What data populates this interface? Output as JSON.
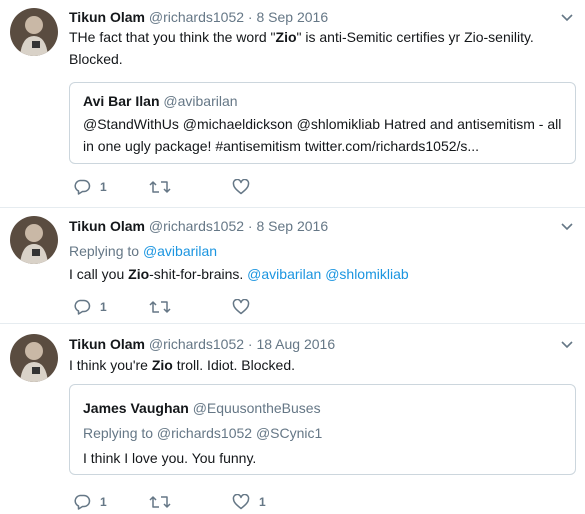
{
  "tweets": [
    {
      "name": "Tikun Olam",
      "handle": "@richards1052",
      "sep": "·",
      "date": "8 Sep 2016",
      "text_before": "THe fact that you think the word \"",
      "text_bold": "Zio",
      "text_after": "\" is anti-Semitic certifies yr Zio-senility. Blocked.",
      "quote": {
        "name": "Avi Bar Ilan",
        "handle": "@avibarilan",
        "text": "@StandWithUs @michaeldickson @shlomikliab Hatred and antisemitism - all in one ugly package! #antisemitism twitter.com/richards1052/s..."
      },
      "reply_count": "1",
      "retweet_count": "",
      "like_count": ""
    },
    {
      "name": "Tikun Olam",
      "handle": "@richards1052",
      "sep": "·",
      "date": "8 Sep 2016",
      "replying_label": "Replying to",
      "replying_to": "@avibarilan",
      "text_before": "I call you ",
      "text_bold": "Zio",
      "text_after": "-shit-for-brains. ",
      "mention1": "@avibarilan",
      "mention2": "@shlomikliab",
      "reply_count": "1",
      "retweet_count": "",
      "like_count": ""
    },
    {
      "name": "Tikun Olam",
      "handle": "@richards1052",
      "sep": "·",
      "date": "18 Aug 2016",
      "text_before": "I think you're ",
      "text_bold": "Zio",
      "text_after": " troll. Idiot. Blocked.",
      "quote": {
        "name": "James Vaughan",
        "handle": "@EquusontheBuses",
        "replying": "Replying to @richards1052 @SCynic1",
        "text": "I think I love you. You funny."
      },
      "reply_count": "1",
      "retweet_count": "",
      "like_count": "1"
    }
  ],
  "colors": {
    "text": "#14171a",
    "muted": "#657786",
    "link": "#1b95e0",
    "border": "#e6ecf0"
  },
  "icons": [
    "reply-icon",
    "retweet-icon",
    "like-icon",
    "chevron-down-icon"
  ]
}
